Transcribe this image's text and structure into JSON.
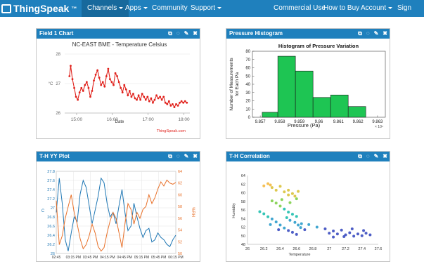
{
  "nav": {
    "brand": "ThingSpeak",
    "trademark": "™",
    "items": [
      "Channels",
      "Apps",
      "Community",
      "Support"
    ],
    "right_items": [
      "Commercial Use",
      "How to Buy",
      "Account",
      "Sign Out"
    ]
  },
  "panels": [
    {
      "title": "Field 1 Chart"
    },
    {
      "title": "Pressure Histogram"
    },
    {
      "title": "T-H YY Plot"
    },
    {
      "title": "T-H Correlation"
    }
  ],
  "icons": [
    "external-link-icon",
    "comment-icon",
    "pencil-icon",
    "close-icon"
  ],
  "chart_data": [
    {
      "type": "line",
      "title": "NC-EAST BME - Temperature Celsius",
      "xlabel": "Date",
      "ylabel": "°C",
      "credit": "ThingSpeak.com",
      "x_ticks": [
        "15:00",
        "16:00",
        "17:00",
        "18:00"
      ],
      "y_ticks": [
        "26",
        "27",
        "28"
      ],
      "ylim": [
        26,
        28
      ],
      "series": [
        {
          "color": "#e0211b",
          "x": [
            "14:48",
            "14:50",
            "14:53",
            "14:56",
            "14:59",
            "15:02",
            "15:05",
            "15:08",
            "15:11",
            "15:14",
            "15:17",
            "15:20",
            "15:23",
            "15:26",
            "15:29",
            "15:32",
            "15:35",
            "15:38",
            "15:41",
            "15:44",
            "15:47",
            "15:50",
            "15:53",
            "15:56",
            "15:59",
            "16:02",
            "16:05",
            "16:08",
            "16:11",
            "16:14",
            "16:17",
            "16:20",
            "16:23",
            "16:26",
            "16:29",
            "16:32",
            "16:35",
            "16:38",
            "16:41",
            "16:44",
            "16:47",
            "16:50",
            "16:53",
            "16:56",
            "16:59",
            "17:02",
            "17:05",
            "17:08",
            "17:11",
            "17:14",
            "17:17",
            "17:20",
            "17:23",
            "17:26",
            "17:29",
            "17:32",
            "17:35",
            "17:38",
            "17:41",
            "17:44",
            "17:47",
            "17:50",
            "17:53",
            "17:56",
            "17:59",
            "18:02",
            "18:05"
          ],
          "values": [
            27.25,
            27.6,
            27.15,
            26.85,
            26.55,
            26.45,
            26.7,
            26.85,
            26.75,
            26.95,
            27.05,
            26.85,
            26.55,
            26.75,
            27.1,
            27.3,
            27.45,
            27.2,
            26.95,
            27.05,
            26.9,
            27.25,
            27.5,
            27.15,
            27.05,
            26.95,
            27.35,
            27.25,
            27.05,
            26.85,
            26.7,
            26.95,
            26.8,
            26.6,
            26.75,
            26.55,
            26.65,
            26.5,
            26.45,
            26.6,
            26.45,
            26.65,
            26.55,
            26.45,
            26.55,
            26.4,
            26.5,
            26.35,
            26.45,
            26.6,
            26.5,
            26.55,
            26.45,
            26.55,
            26.35,
            26.3,
            26.4,
            26.25,
            26.3,
            26.2,
            26.3,
            26.25,
            26.35,
            26.4,
            26.35,
            26.4,
            26.35
          ]
        }
      ]
    },
    {
      "type": "bar",
      "title": "Histogram of Pressure Variation",
      "xlabel": "Pressure (Pa)",
      "ylabel": "Number of Measurements for Each Pa",
      "x_exponent": "× 10⁴",
      "x_ticks": [
        "9.857",
        "9.858",
        "9.859",
        "9.86",
        "9.861",
        "9.862",
        "9.863"
      ],
      "y_ticks": [
        "0",
        "10",
        "20",
        "30",
        "40",
        "50",
        "60",
        "70",
        "80"
      ],
      "ylim": [
        0,
        80
      ],
      "bin_edges": [
        9.8571,
        9.8579,
        9.8588,
        9.8597,
        9.8606,
        9.8615,
        9.8624
      ],
      "values": [
        6,
        74,
        56,
        24,
        27,
        13
      ],
      "color": "#1ec553"
    },
    {
      "type": "line",
      "xlabel": "",
      "y_left_label": "C",
      "y_right_label": "%RH",
      "x_ticks": [
        "02:45",
        "03:15 PM",
        "03:45 PM",
        "04:15 PM",
        "04:45 PM",
        "05:15 PM",
        "05:45 PM",
        "06:15 PM"
      ],
      "y_left_ticks": [
        "26",
        "26.2",
        "26.4",
        "26.6",
        "26.8",
        "27",
        "27.2",
        "27.4",
        "27.6",
        "27.8"
      ],
      "y_right_ticks": [
        "50",
        "52",
        "54",
        "56",
        "58",
        "60",
        "62",
        "64"
      ],
      "ylim_left": [
        26,
        27.8
      ],
      "ylim_right": [
        50,
        64
      ],
      "series": [
        {
          "name": "Temperature",
          "axis": "left",
          "color": "#1f77b4",
          "values": [
            26.9,
            27.65,
            27.1,
            26.3,
            26.05,
            26.45,
            26.8,
            26.7,
            27.3,
            27.6,
            27.45,
            27.05,
            26.65,
            26.95,
            27.25,
            27.65,
            27.55,
            27.1,
            26.8,
            26.9,
            26.65,
            27.05,
            27.4,
            26.9,
            26.5,
            26.6,
            27.1,
            26.8,
            26.55,
            26.35,
            26.5,
            26.55,
            26.25,
            26.3,
            26.45,
            26.35,
            26.3,
            26.2,
            26.15,
            26.3,
            26.4
          ]
        },
        {
          "name": "Humidity",
          "axis": "right",
          "color": "#e8712a",
          "values": [
            59,
            51.5,
            53,
            56,
            58,
            60,
            57,
            55,
            52.5,
            50.8,
            51.5,
            53,
            55,
            53.5,
            51.2,
            50.4,
            51,
            53.5,
            55.5,
            57,
            56,
            53.5,
            51,
            55,
            58.5,
            57.5,
            55,
            57,
            56,
            57.5,
            58,
            60,
            58.5,
            59.5,
            61,
            62.2,
            61.5,
            62.5,
            62,
            61.8,
            62.1
          ]
        }
      ]
    },
    {
      "type": "scatter",
      "xlabel": "Temperature",
      "ylabel": "Humidity",
      "x_ticks": [
        "26",
        "26.2",
        "26.4",
        "26.6",
        "26.8",
        "27",
        "27.2",
        "27.4",
        "27.6"
      ],
      "y_ticks": [
        "48",
        "50",
        "52",
        "54",
        "56",
        "58",
        "60",
        "62",
        "64"
      ],
      "xlim": [
        26,
        27.6
      ],
      "ylim": [
        48,
        64
      ],
      "points": [
        [
          26.2,
          61.6
        ],
        [
          26.25,
          62.1
        ],
        [
          26.3,
          61.2
        ],
        [
          26.35,
          60.6
        ],
        [
          26.28,
          61.8
        ],
        [
          26.4,
          61.5
        ],
        [
          26.45,
          60.2
        ],
        [
          26.5,
          60.6
        ],
        [
          26.55,
          59.8
        ],
        [
          26.6,
          58.6
        ],
        [
          26.5,
          59.5
        ],
        [
          26.42,
          58.4
        ],
        [
          26.52,
          57.7
        ],
        [
          26.58,
          59.2
        ],
        [
          26.62,
          60.3
        ],
        [
          26.3,
          58.1
        ],
        [
          26.35,
          57.6
        ],
        [
          26.4,
          56.9
        ],
        [
          26.45,
          56.2
        ],
        [
          26.5,
          55.5
        ],
        [
          26.55,
          55.0
        ],
        [
          26.48,
          54.2
        ],
        [
          26.52,
          53.6
        ],
        [
          26.58,
          53.1
        ],
        [
          26.62,
          52.5
        ],
        [
          26.65,
          51.9
        ],
        [
          26.7,
          51.4
        ],
        [
          26.6,
          54.5
        ],
        [
          26.66,
          52.8
        ],
        [
          26.15,
          55.6
        ],
        [
          26.2,
          55.1
        ],
        [
          26.25,
          54.4
        ],
        [
          26.3,
          53.9
        ],
        [
          26.35,
          53.2
        ],
        [
          26.4,
          52.5
        ],
        [
          26.45,
          51.8
        ],
        [
          26.5,
          51.2
        ],
        [
          26.55,
          50.8
        ],
        [
          26.6,
          50.3
        ],
        [
          26.38,
          51.4
        ],
        [
          26.28,
          52.6
        ],
        [
          26.75,
          52.6
        ],
        [
          26.85,
          52.0
        ],
        [
          26.95,
          51.6
        ],
        [
          27.0,
          50.6
        ],
        [
          27.05,
          51.1
        ],
        [
          27.1,
          50.4
        ],
        [
          27.15,
          51.3
        ],
        [
          27.2,
          50.2
        ],
        [
          27.25,
          50.7
        ],
        [
          27.3,
          49.9
        ],
        [
          27.35,
          50.4
        ],
        [
          27.4,
          50.0
        ],
        [
          27.45,
          50.6
        ],
        [
          27.5,
          50.2
        ],
        [
          27.18,
          49.8
        ],
        [
          27.28,
          51.6
        ],
        [
          27.05,
          49.7
        ],
        [
          27.42,
          51.2
        ]
      ],
      "colormap": [
        "#3b4cc0",
        "#2c9ccb",
        "#1fbfae",
        "#7fcf4a",
        "#d9c23c",
        "#f4b942"
      ]
    }
  ]
}
